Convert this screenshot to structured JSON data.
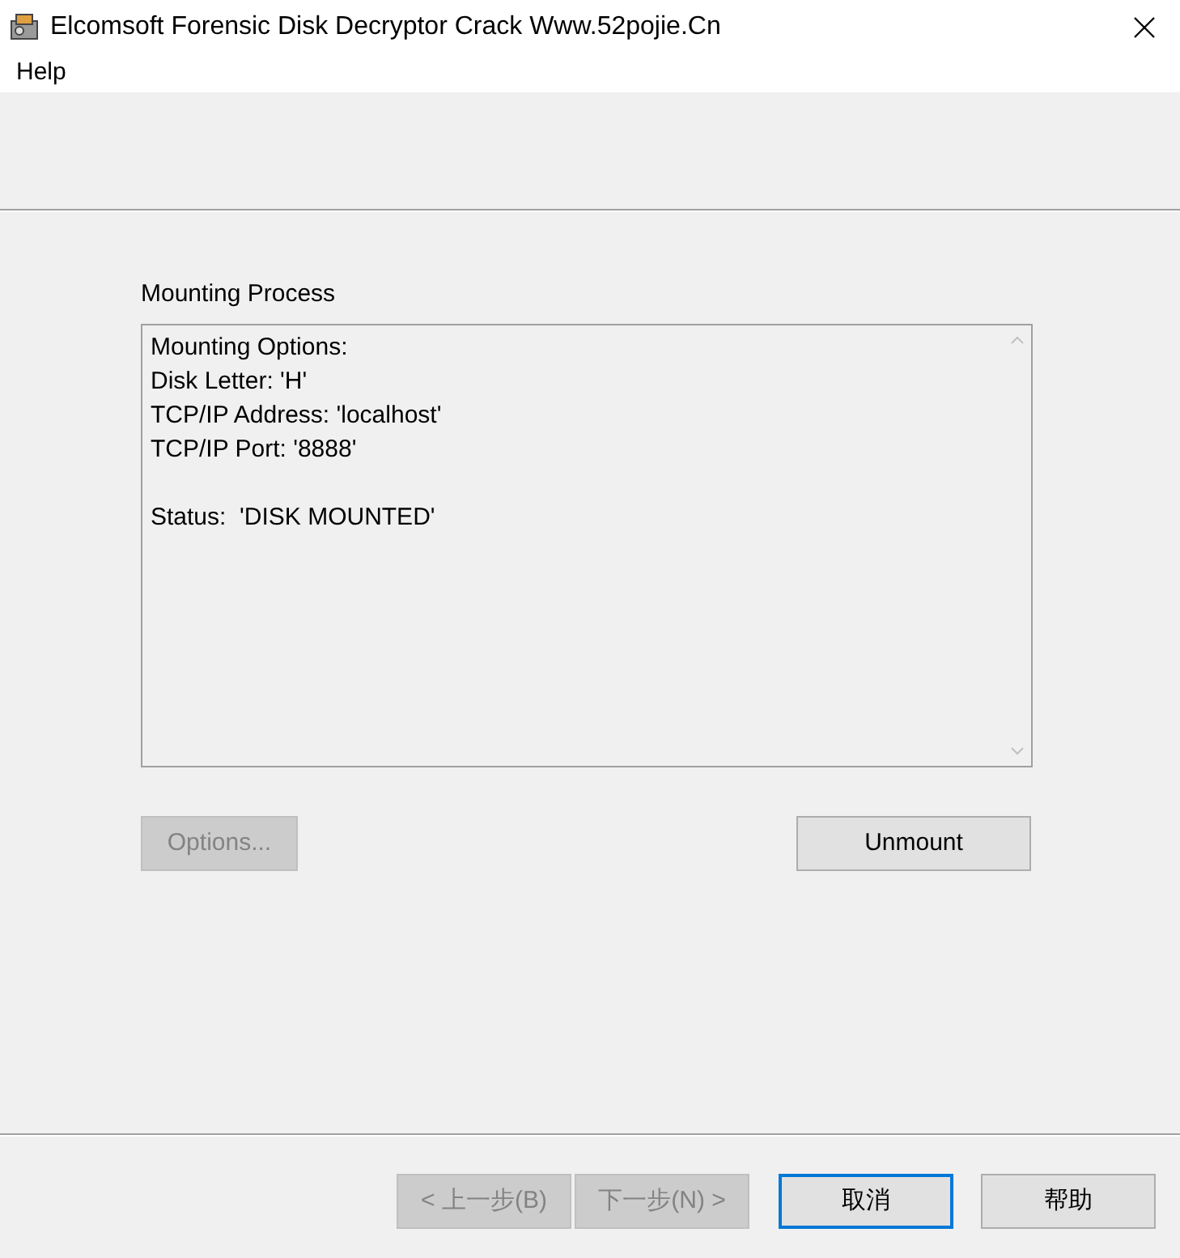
{
  "window": {
    "title": "Elcomsoft Forensic Disk Decryptor Crack Www.52pojie.Cn"
  },
  "menu": [
    "Help"
  ],
  "section_label": "Mounting Process",
  "log": {
    "paragraphs": [
      [
        "Mounting Options:",
        "Disk Letter: 'H'",
        "TCP/IP Address: 'localhost'",
        "TCP/IP Port: '8888'"
      ],
      [
        "Status:  'DISK MOUNTED'"
      ]
    ]
  },
  "actions": [
    {
      "label": "Options...",
      "disabled": true
    },
    {
      "label": "Unmount",
      "disabled": false
    }
  ],
  "wizard_buttons": [
    {
      "label": "< 上一步(B)",
      "disabled": true,
      "focused": false
    },
    {
      "label": "下一步(N) >",
      "disabled": true,
      "focused": false
    },
    {
      "label": "取消",
      "disabled": false,
      "focused": true
    },
    {
      "label": "帮助",
      "disabled": false,
      "focused": false
    }
  ]
}
